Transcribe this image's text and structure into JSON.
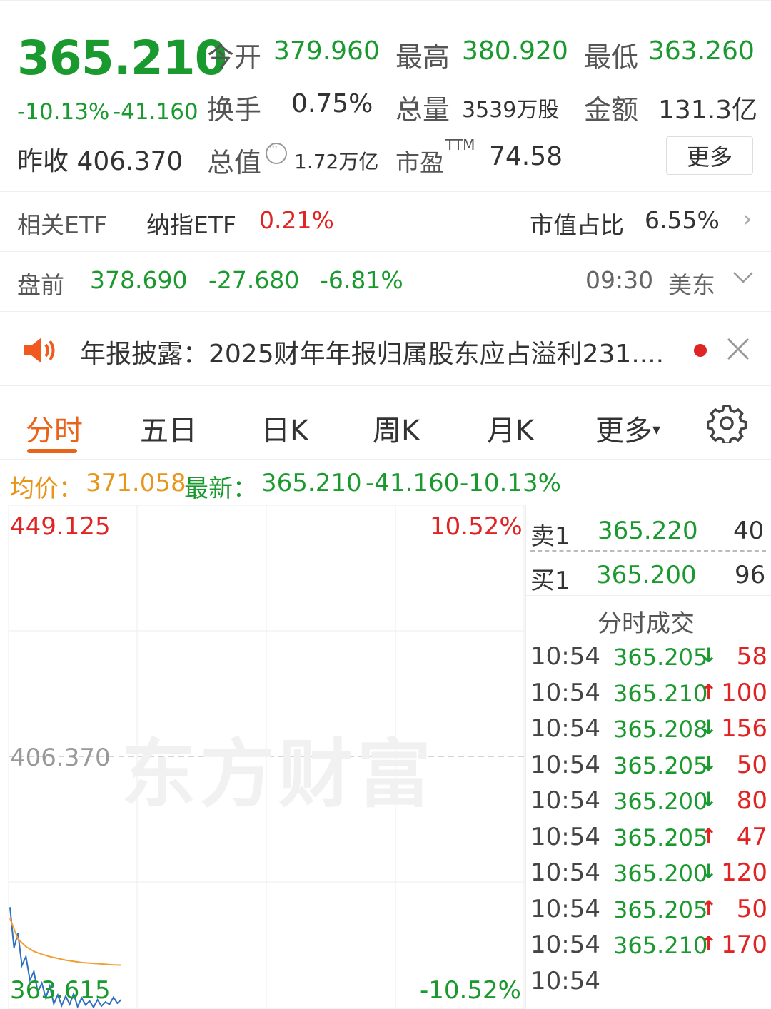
{
  "quote": {
    "price": "365.210",
    "change_pct": "-10.13%",
    "change": "-41.160",
    "prev_close_label": "昨收",
    "prev_close": "406.370",
    "open_label": "今开",
    "open": "379.960",
    "high_label": "最高",
    "high": "380.920",
    "low_label": "最低",
    "low": "363.260",
    "turnover_label": "换手",
    "turnover": "0.75%",
    "volume_label": "总量",
    "volume": "3539万股",
    "amount_label": "金额",
    "amount": "131.3亿",
    "mktcap_label": "总值",
    "mktcap": "1.72万亿",
    "pe_label": "市盈",
    "pe_sup": "TTM",
    "pe": "74.58",
    "more_label": "更多"
  },
  "etf": {
    "label": "相关ETF",
    "name": "纳指ETF",
    "pct": "0.21%",
    "share_label": "市值占比",
    "share": "6.55%"
  },
  "premarket": {
    "label": "盘前",
    "price": "378.690",
    "change": "-27.680",
    "pct": "-6.81%",
    "time": "09:30",
    "tz": "美东"
  },
  "notice": {
    "text": "年报披露：2025财年年报归属股东应占溢利231...."
  },
  "tabs": [
    "分时",
    "五日",
    "日K",
    "周K",
    "月K",
    "更多"
  ],
  "avg": {
    "avg_label": "均价：",
    "avg_value": "371.058",
    "latest_label": "最新：",
    "latest_value": "365.210",
    "change": "-41.160",
    "pct": "-10.13%"
  },
  "chart_data": {
    "type": "line",
    "y_top": "449.125",
    "y_mid": "406.370",
    "y_bottom": "363.615",
    "pct_top": "10.52%",
    "pct_bottom": "-10.52%",
    "ylim": [
      363.615,
      449.125
    ],
    "series": [
      {
        "values": [
          380.9,
          374.0,
          376.5,
          371.0,
          372.5,
          368.5,
          370.0,
          366.5,
          368.0,
          365.5,
          367.5,
          364.5,
          366.0,
          364.2,
          365.8,
          364.4,
          366.2,
          364.0,
          365.5,
          364.3,
          365.0,
          363.9,
          365.2,
          364.1,
          364.8,
          364.4,
          365.6,
          364.6,
          365.21
        ]
      },
      {
        "values": [
          379.0,
          375.5,
          374.2,
          373.4,
          372.9,
          372.5,
          372.2,
          371.9,
          371.7,
          371.5,
          371.4,
          371.3,
          371.2,
          371.1,
          371.06
        ]
      }
    ]
  },
  "watermark": "东方财富",
  "book": {
    "sell_label": "卖1",
    "sell_price": "365.220",
    "sell_qty": "40",
    "buy_label": "买1",
    "buy_price": "365.200",
    "buy_qty": "96",
    "trades_title": "分时成交",
    "trades": [
      {
        "time": "10:54",
        "price": "365.205",
        "dir": "down",
        "qty": "58"
      },
      {
        "time": "10:54",
        "price": "365.210",
        "dir": "up",
        "qty": "100"
      },
      {
        "time": "10:54",
        "price": "365.208",
        "dir": "down",
        "qty": "156"
      },
      {
        "time": "10:54",
        "price": "365.205",
        "dir": "down",
        "qty": "50"
      },
      {
        "time": "10:54",
        "price": "365.200",
        "dir": "down",
        "qty": "80"
      },
      {
        "time": "10:54",
        "price": "365.205",
        "dir": "up",
        "qty": "47"
      },
      {
        "time": "10:54",
        "price": "365.200",
        "dir": "down",
        "qty": "120"
      },
      {
        "time": "10:54",
        "price": "365.205",
        "dir": "up",
        "qty": "50"
      },
      {
        "time": "10:54",
        "price": "365.210",
        "dir": "up",
        "qty": "170"
      },
      {
        "time": "10:54",
        "price": "",
        "dir": "",
        "qty": ""
      }
    ]
  }
}
